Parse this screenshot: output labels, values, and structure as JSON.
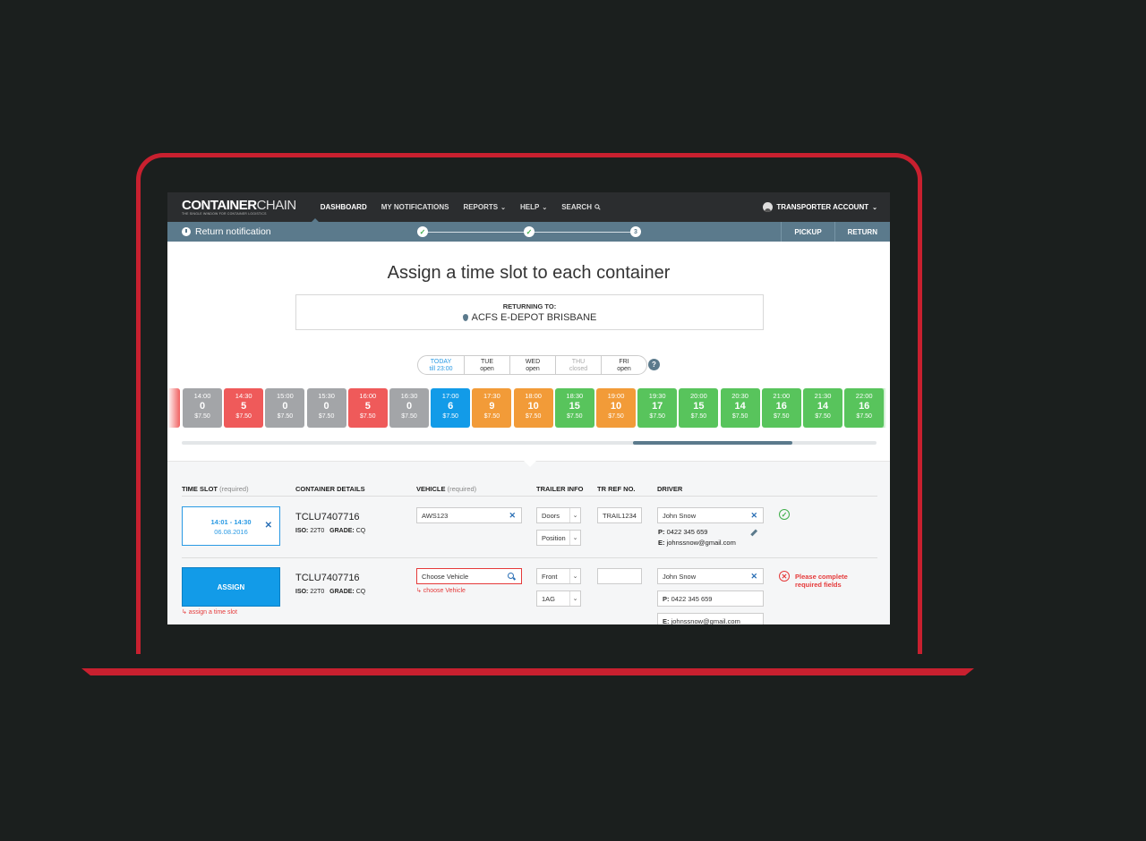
{
  "colors": {
    "brand_red": "#c8202f",
    "nav_dark": "#2b2d2f",
    "slate": "#5b7a8c",
    "blue": "#129be8",
    "grey_slot": "#a3a5a8",
    "red_slot": "#ef5a5a",
    "orange_slot": "#f29b38",
    "green_slot": "#58c45c",
    "error": "#e53a3a"
  },
  "nav": {
    "logo_bold": "CONTAINER",
    "logo_bold2": "CHAIN",
    "logo_tagline": "THE SINGLE WINDOW FOR CONTAINER LOGISTICS",
    "items": [
      {
        "label": "DASHBOARD"
      },
      {
        "label": "MY NOTIFICATIONS"
      },
      {
        "label": "REPORTS",
        "caret": "⌄"
      },
      {
        "label": "HELP",
        "caret": "⌄"
      },
      {
        "label": "SEARCH",
        "icon": "search-icon"
      }
    ],
    "account": "TRANSPORTER ACCOUNT",
    "account_caret": "⌄"
  },
  "subbar": {
    "title": "Return notification",
    "steps": [
      "✓",
      "✓",
      "3"
    ],
    "buttons": [
      "PICKUP",
      "RETURN"
    ]
  },
  "heading": "Assign a time slot to each container",
  "returning": {
    "label": "RETURNING TO:",
    "value": "ACFS E-DEPOT BRISBANE"
  },
  "days": [
    {
      "name": "TODAY",
      "status": "till 23:00"
    },
    {
      "name": "TUE",
      "status": "open"
    },
    {
      "name": "WED",
      "status": "open"
    },
    {
      "name": "THU",
      "status": "closed"
    },
    {
      "name": "FRI",
      "status": "open"
    }
  ],
  "help": "?",
  "slots": [
    {
      "time": "14:00",
      "count": "0",
      "price": "$7.50",
      "color": "grey"
    },
    {
      "time": "14:30",
      "count": "5",
      "price": "$7.50",
      "color": "red"
    },
    {
      "time": "15:00",
      "count": "0",
      "price": "$7.50",
      "color": "grey"
    },
    {
      "time": "15:30",
      "count": "0",
      "price": "$7.50",
      "color": "grey"
    },
    {
      "time": "16:00",
      "count": "5",
      "price": "$7.50",
      "color": "red"
    },
    {
      "time": "16:30",
      "count": "0",
      "price": "$7.50",
      "color": "grey"
    },
    {
      "time": "17:00",
      "count": "6",
      "price": "$7.50",
      "color": "blue"
    },
    {
      "time": "17:30",
      "count": "9",
      "price": "$7.50",
      "color": "orange"
    },
    {
      "time": "18:00",
      "count": "10",
      "price": "$7.50",
      "color": "orange"
    },
    {
      "time": "18:30",
      "count": "15",
      "price": "$7.50",
      "color": "green"
    },
    {
      "time": "19:00",
      "count": "10",
      "price": "$7.50",
      "color": "orange"
    },
    {
      "time": "19:30",
      "count": "17",
      "price": "$7.50",
      "color": "green"
    },
    {
      "time": "20:00",
      "count": "15",
      "price": "$7.50",
      "color": "green"
    },
    {
      "time": "20:30",
      "count": "14",
      "price": "$7.50",
      "color": "green"
    },
    {
      "time": "21:00",
      "count": "16",
      "price": "$7.50",
      "color": "green"
    },
    {
      "time": "21:30",
      "count": "14",
      "price": "$7.50",
      "color": "green"
    },
    {
      "time": "22:00",
      "count": "16",
      "price": "$7.50",
      "color": "green"
    }
  ],
  "table": {
    "headers": {
      "time_slot": "TIME SLOT",
      "time_slot_req": "(required)",
      "container": "CONTAINER DETAILS",
      "vehicle": "VEHICLE",
      "vehicle_req": "(required)",
      "trailer": "TRAILER INFO",
      "tr_ref": "TR REF NO.",
      "driver": "DRIVER"
    },
    "rows": [
      {
        "slot_time": "14:01 - 14:30",
        "slot_date": "06.08.2016",
        "container": "TCLU7407716",
        "iso_label": "ISO:",
        "iso": "22T0",
        "grade_label": "GRADE:",
        "grade": "CQ",
        "vehicle": "AWS123",
        "trailer_1": "Doors",
        "trailer_2": "Position",
        "tr_ref": "TRAIL1234",
        "driver": "John Snow",
        "phone_label": "P:",
        "phone": "0422 345 659",
        "email_label": "E:",
        "email": "johnssnow@gmail.com"
      },
      {
        "assign_label": "ASSIGN",
        "assign_error": "↳ assign a time slot",
        "container": "TCLU7407716",
        "iso_label": "ISO:",
        "iso": "22T0",
        "grade_label": "GRADE:",
        "grade": "CQ",
        "vehicle_placeholder": "Choose Vehicle",
        "vehicle_error": "↳ choose Vehicle",
        "trailer_1": "Front",
        "trailer_2": "1AG",
        "tr_ref": "",
        "driver": "John Snow",
        "phone_label": "P:",
        "phone": "0422 345 659",
        "email_label": "E:",
        "email": "johnssnow@gmail.com",
        "error_message_1": "Please complete",
        "error_message_2": "required fields"
      }
    ]
  }
}
